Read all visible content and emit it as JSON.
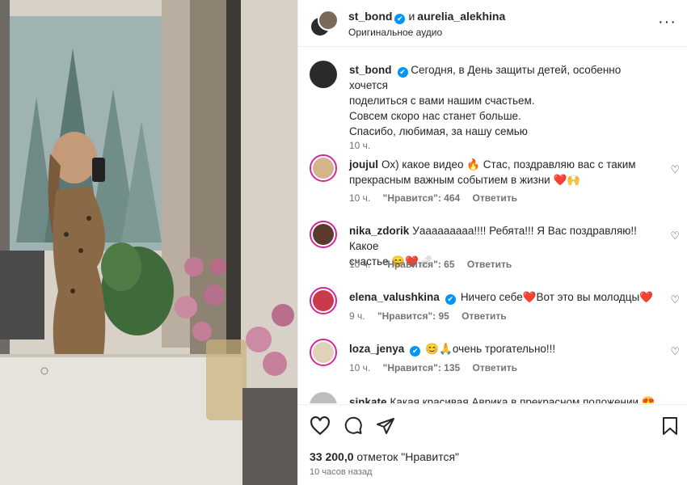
{
  "header": {
    "user1": "st_bond",
    "conj": "и",
    "user2": "aurelia_alekhina",
    "subtitle": "Оригинальное аудио",
    "more": "···"
  },
  "caption": {
    "username": "st_bond",
    "text_line1": "Сегодня, в День защиты детей, особенно хочется",
    "text_line2": "поделиться с вами нашим счастьем.",
    "text_line3": "Совсем скоро нас станет больше.",
    "text_line4": "Спасибо, любимая, за нашу семью",
    "time": "10 ч."
  },
  "comments": [
    {
      "username": "joujul",
      "text_line1": "Ох) какое видео 🔥 Стас, поздравляю вас с таким",
      "text_line2": "прекрасным важным событием в жизни ❤️🙌",
      "time": "10 ч.",
      "likes": "\"Нравится\": 464",
      "reply": "Ответить"
    },
    {
      "username": "nika_zdorik",
      "text_line1": "Уааааааааа!!!! Ребята!!! Я Вас поздравляю!! Какое",
      "text_line2": "счастье 😊❤️🩹",
      "time": "10 ч.",
      "likes": "\"Нравится\": 65",
      "reply": "Ответить"
    },
    {
      "username": "elena_valushkina",
      "text_line1": "Ничего себе❤️Вот это вы молодцы❤️",
      "time": "9 ч.",
      "likes": "\"Нравится\": 95",
      "reply": "Ответить"
    },
    {
      "username": "loza_jenya",
      "text_line1": "😊🙏очень трогательно!!!",
      "time": "10 ч.",
      "likes": "\"Нравится\": 135",
      "reply": "Ответить"
    },
    {
      "username": "sinkate",
      "text_line1": "Какая красивая Аврика в прекрасном положении 😍"
    }
  ],
  "footer": {
    "likes_count": "33 200,0",
    "likes_label": "отметок \"Нравится\"",
    "time": "10 часов назад"
  },
  "colors": {
    "verified": "#0095f6",
    "story_ring": "#d6249f",
    "muted_text": "#737373"
  }
}
